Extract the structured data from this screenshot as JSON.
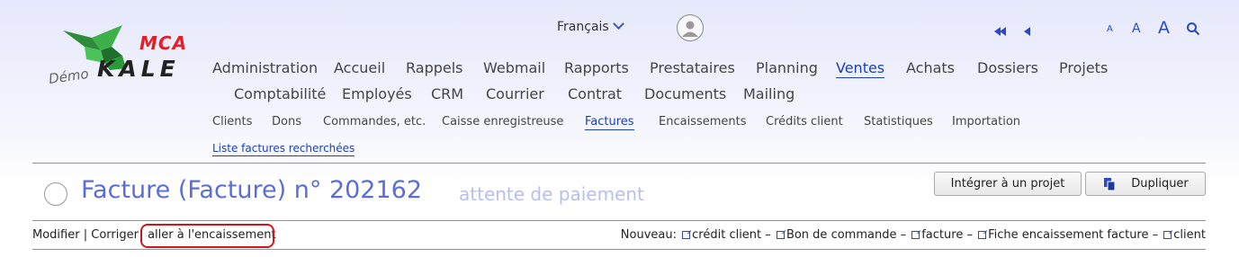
{
  "logo": {
    "brand_top": "MCA",
    "brand_main": "KALE",
    "prefix": "Démo"
  },
  "header": {
    "language": "Français",
    "font_sizes": [
      "A",
      "A",
      "A"
    ]
  },
  "main_menu": {
    "row1": [
      "Administration",
      "Accueil",
      "Rappels",
      "Webmail",
      "Rapports",
      "Prestataires",
      "Planning",
      "Ventes",
      "Achats",
      "Dossiers",
      "Projets"
    ],
    "row2": [
      "Comptabilité",
      "Employés",
      "CRM",
      "Courrier",
      "Contrat",
      "Documents",
      "Mailing"
    ],
    "active": "Ventes"
  },
  "sub_menu": {
    "items": [
      "Clients",
      "Dons",
      "Commandes, etc.",
      "Caisse enregistreuse",
      "Factures",
      "Encaissements",
      "Crédits client",
      "Statistiques",
      "Importation"
    ],
    "active": "Factures",
    "secondary": "Liste factures recherchées"
  },
  "page": {
    "title": "Facture (Facture) n° 202162",
    "status": "attente de paiement",
    "buttons": {
      "integrate": "Intégrer à un projet",
      "duplicate": "Dupliquer"
    }
  },
  "actions": {
    "modify": "Modifier",
    "separator": "|",
    "correct": "Corriger",
    "goto_payment": "aller à l'encaissement"
  },
  "nouveau": {
    "label": "Nouveau:",
    "links": [
      "crédit client",
      "Bon de commande",
      "facture",
      "Fiche encaissement facture",
      "client"
    ],
    "separator": "–"
  },
  "colors": {
    "accent": "#1b3fb8",
    "title": "#5b6dd6",
    "highlight": "#d3141b",
    "logo_red": "#e3202a"
  }
}
